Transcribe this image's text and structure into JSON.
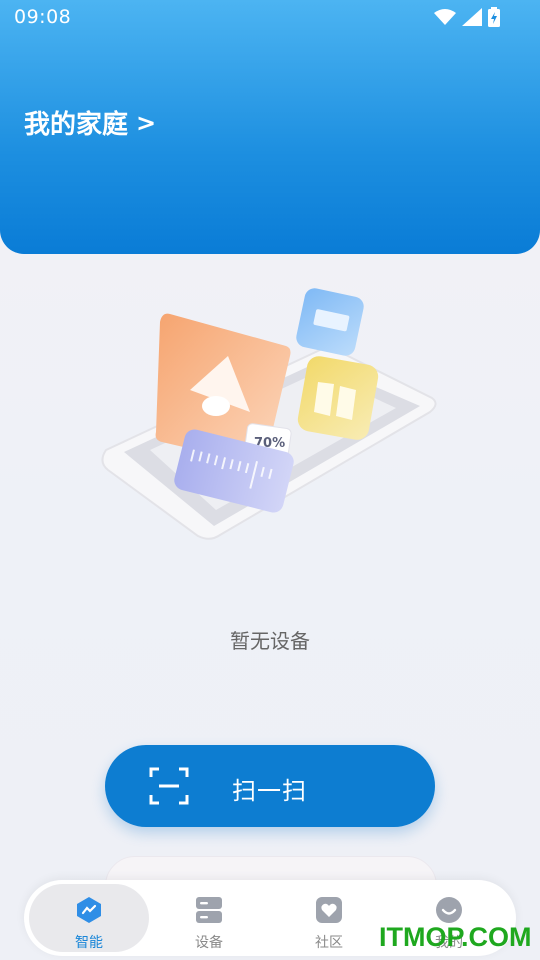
{
  "status_bar": {
    "time": "09:08"
  },
  "header": {
    "home_title": "我的家庭",
    "chevron": ">"
  },
  "illustration": {
    "percent_label": "70%"
  },
  "empty_state": {
    "text": "暂无设备"
  },
  "scan_button": {
    "label": "扫一扫"
  },
  "bottom_nav": {
    "items": [
      {
        "label": "智能",
        "icon": "smart-icon",
        "active": true
      },
      {
        "label": "设备",
        "icon": "devices-icon",
        "active": false
      },
      {
        "label": "社区",
        "icon": "community-icon",
        "active": false
      },
      {
        "label": "我的",
        "icon": "profile-icon",
        "active": false
      }
    ]
  },
  "watermark": {
    "text": "ITMOP.COM"
  },
  "colors": {
    "header_top": "#4cb4f2",
    "header_bottom": "#0a7cd6",
    "primary_button": "#0d7dd1",
    "active_nav": "#1a86d8",
    "watermark": "#1fa81f"
  }
}
